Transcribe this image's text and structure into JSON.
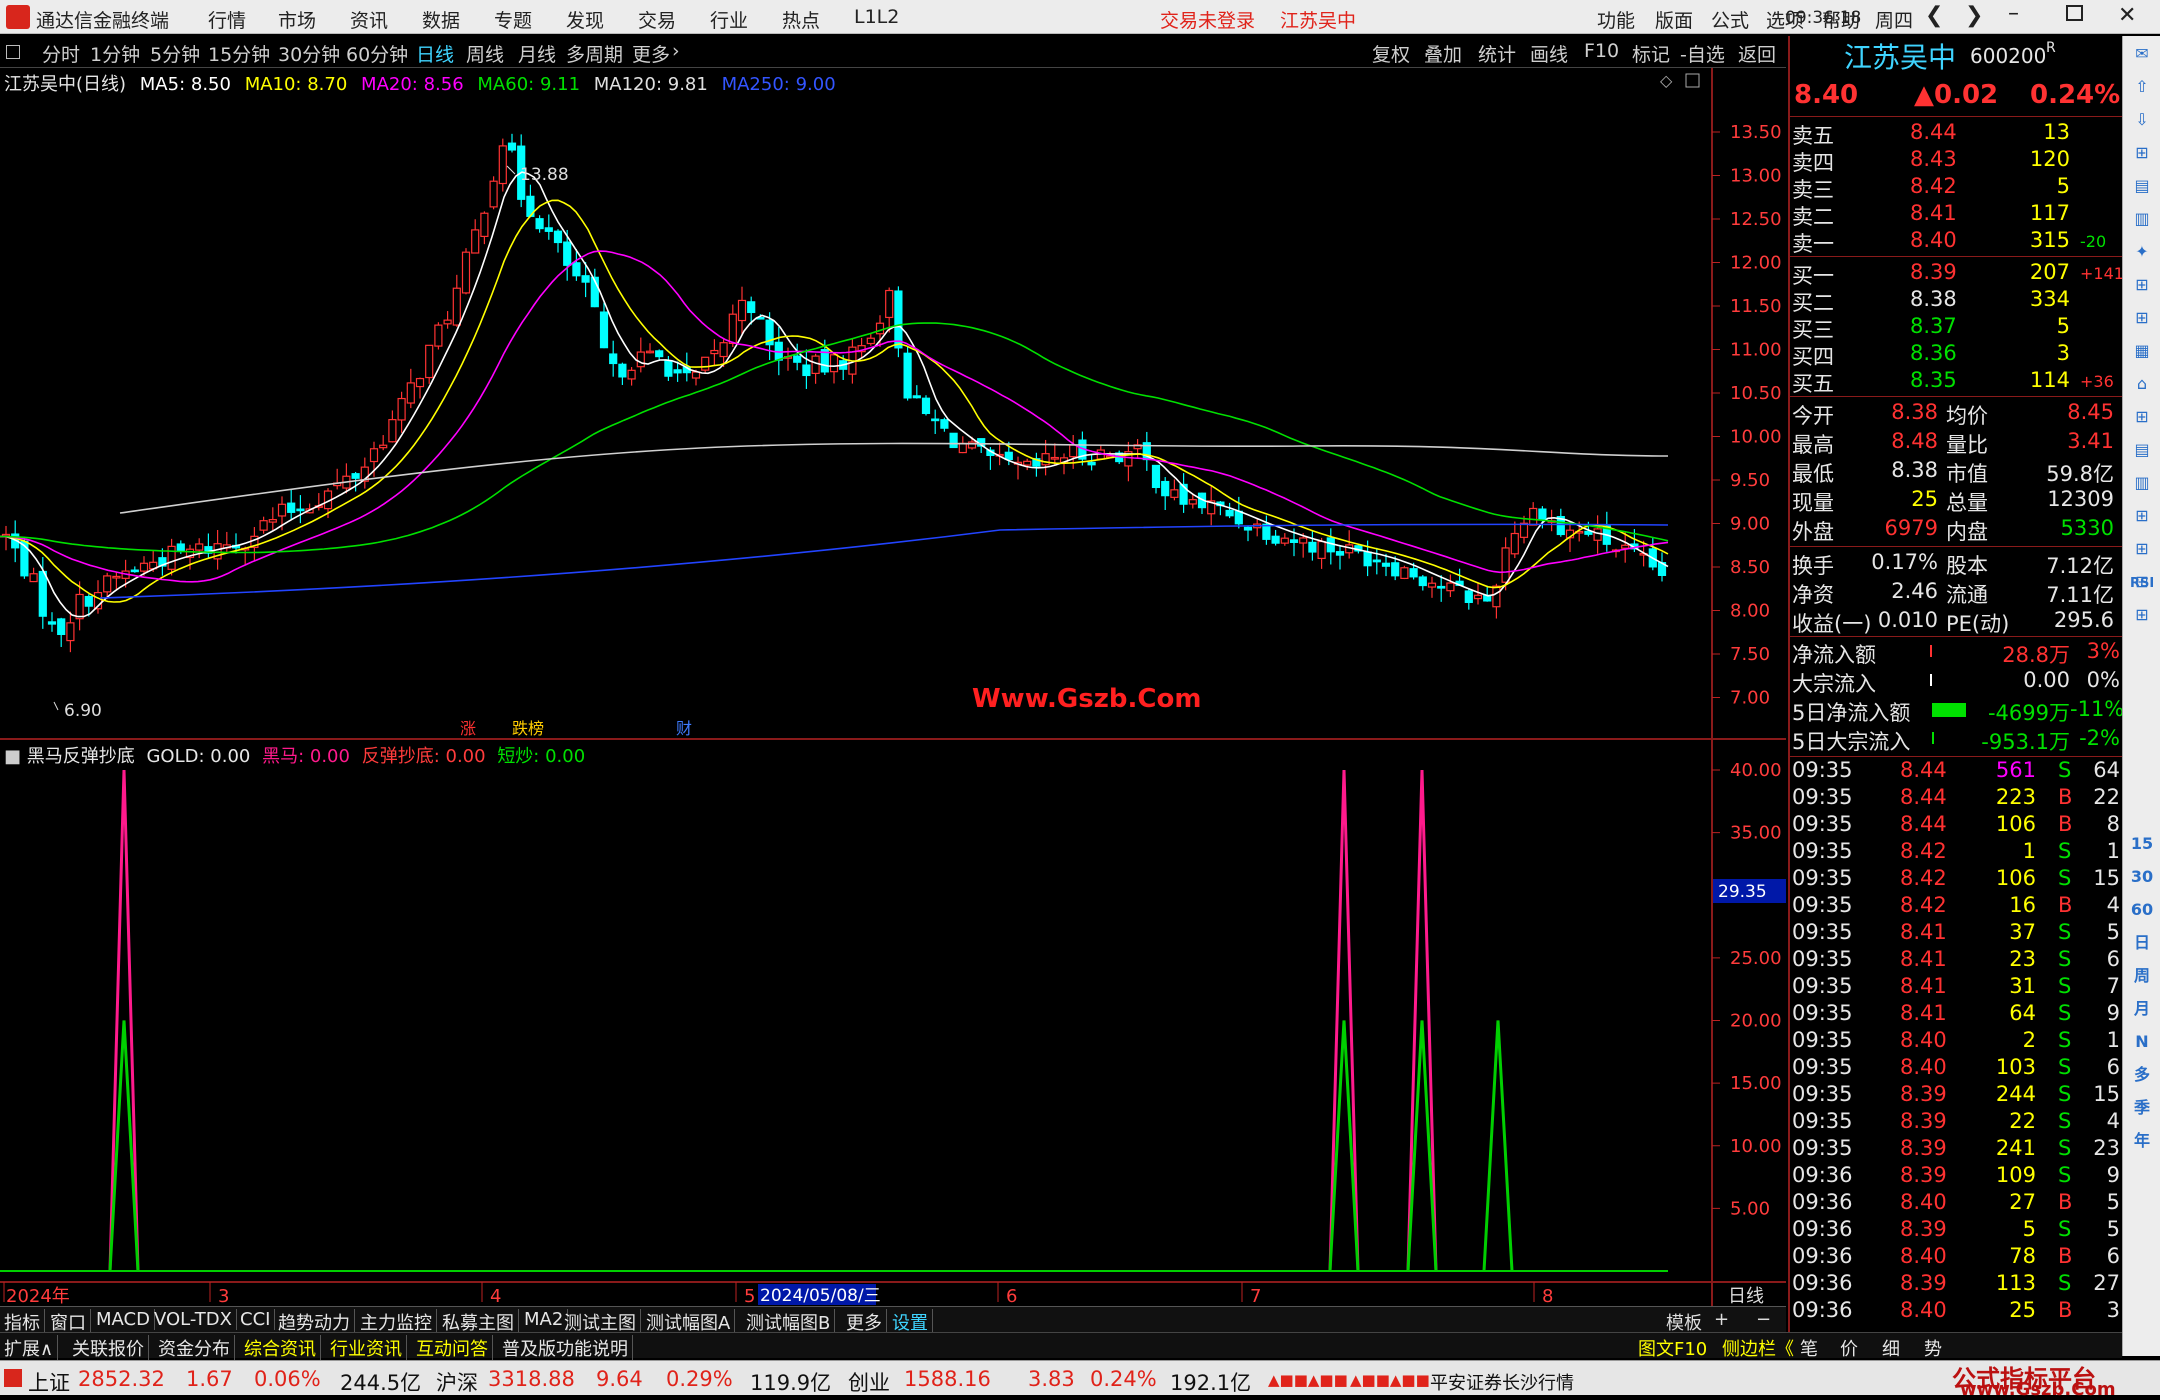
{
  "app": {
    "title": "通达信金融终端",
    "menu": [
      "行情",
      "市场",
      "资讯",
      "数据",
      "专题",
      "发现",
      "交易",
      "行业",
      "热点",
      "L1L2"
    ],
    "trade_status": "交易未登录",
    "stock_name_title": "江苏吴中",
    "menu_right": [
      "功能",
      "版面",
      "公式",
      "选项",
      "帮助"
    ],
    "time": "09:36:18",
    "weekday": "周四"
  },
  "periods": [
    "分时",
    "1分钟",
    "5分钟",
    "15分钟",
    "30分钟",
    "60分钟",
    "日线",
    "周线",
    "月线",
    "多周期",
    "更多"
  ],
  "toolbar_right": [
    "复权",
    "叠加",
    "统计",
    "画线",
    "F10",
    "标记",
    "-自选",
    "返回"
  ],
  "kline": {
    "header": {
      "stock": "江苏吴中(日线)",
      "ma5": "MA5: 8.50",
      "ma10": "MA10: 8.70",
      "ma20": "MA20: 8.56",
      "ma60": "MA60: 9.11",
      "ma120": "MA120: 9.81",
      "ma250": "MA250: 9.00"
    },
    "high_mark": "13.88",
    "low_mark": "6.90",
    "y_ticks": [
      "13.50",
      "13.00",
      "12.50",
      "12.00",
      "11.50",
      "11.00",
      "10.50",
      "10.00",
      "9.50",
      "9.00",
      "8.50",
      "8.00",
      "7.50",
      "7.00"
    ],
    "badges": [
      "涨",
      "跌榜",
      "财"
    ],
    "watermark": "Www.Gszb.Com",
    "colors": {
      "ma5": "#ffffff",
      "ma10": "#ffff00",
      "ma20": "#ff00ff",
      "ma60": "#00e000",
      "ma120": "#e0e0e0",
      "ma250": "#2244ff",
      "up": "#ff3232",
      "down": "#00ffff"
    }
  },
  "chart_data": [
    {
      "type": "candlestick",
      "title": "江苏吴中(日线)",
      "ylim": [
        6.8,
        14.0
      ],
      "y_high": 13.88,
      "y_low": 6.9,
      "series": [
        {
          "name": "MA5"
        },
        {
          "name": "MA10"
        },
        {
          "name": "MA20"
        },
        {
          "name": "MA60"
        },
        {
          "name": "MA120"
        },
        {
          "name": "MA250"
        }
      ]
    },
    {
      "type": "line",
      "title": "黑马反弹抄底",
      "ylim": [
        0,
        42
      ],
      "series": [
        {
          "name": "黑马",
          "color": "#ff1a8c",
          "peaks": [
            {
              "x": "2024-03-06",
              "y": 40
            },
            {
              "x": "2024-07-30",
              "y": 40
            },
            {
              "x": "2024-08-05",
              "y": 40
            }
          ]
        },
        {
          "name": "反弹抄底",
          "color": "#00d000",
          "peaks": [
            {
              "x": "2024-03-06",
              "y": 20
            },
            {
              "x": "2024-07-30",
              "y": 20
            },
            {
              "x": "2024-08-05",
              "y": 20
            },
            {
              "x": "2024-08-12",
              "y": 20
            }
          ]
        }
      ]
    }
  ],
  "indicator": {
    "header": {
      "name": "黑马反弹抄底",
      "gold": "GOLD: 0.00",
      "heima": "黑马: 0.00",
      "fantan": "反弹抄底: 0.00",
      "duanchao": "短炒: 0.00"
    },
    "y_ticks": [
      "40.00",
      "35.00",
      "25.00",
      "20.00",
      "15.00",
      "10.00",
      "5.00"
    ],
    "cursor_value": "29.35"
  },
  "x_axis": {
    "labels": [
      "2024年",
      "3",
      "4",
      "5",
      "6",
      "7",
      "8"
    ],
    "cursor_date": "2024/05/08/三",
    "period": "日线"
  },
  "tabs_indicator": [
    "指标",
    "窗口",
    "MACD",
    "VOL-TDX",
    "CCI",
    "趋势动力",
    "主力监控",
    "私募主图",
    "MA2",
    "测试主图",
    "测试幅图A",
    "测试幅图B",
    "更多",
    "设置"
  ],
  "tabs_right": [
    "模板",
    "+",
    "−"
  ],
  "tabs_info": [
    "扩展∧",
    "关联报价",
    "资金分布",
    "综合资讯",
    "行业资讯",
    "互动问答",
    "普及版功能说明"
  ],
  "tabs_info_right": [
    "图文F10",
    "侧边栏《",
    "笔",
    "价",
    "细",
    "势"
  ],
  "quote": {
    "name": "江苏吴中",
    "code": "600200",
    "flag": "R",
    "price": "8.40",
    "change": "▲0.02",
    "pct": "0.24%",
    "sell": [
      {
        "label": "卖五",
        "price": "8.44",
        "vol": "13",
        "chg": ""
      },
      {
        "label": "卖四",
        "price": "8.43",
        "vol": "120",
        "chg": ""
      },
      {
        "label": "卖三",
        "price": "8.42",
        "vol": "5",
        "chg": ""
      },
      {
        "label": "卖二",
        "price": "8.41",
        "vol": "117",
        "chg": ""
      },
      {
        "label": "卖一",
        "price": "8.40",
        "vol": "315",
        "chg": "-20"
      }
    ],
    "buy": [
      {
        "label": "买一",
        "price": "8.39",
        "vol": "207",
        "chg": "+141"
      },
      {
        "label": "买二",
        "price": "8.38",
        "vol": "334",
        "chg": ""
      },
      {
        "label": "买三",
        "price": "8.37",
        "vol": "5",
        "chg": ""
      },
      {
        "label": "买四",
        "price": "8.36",
        "vol": "3",
        "chg": ""
      },
      {
        "label": "买五",
        "price": "8.35",
        "vol": "114",
        "chg": "+36"
      }
    ],
    "stats": [
      {
        "l1": "今开",
        "v1": "8.38",
        "l2": "均价",
        "v2": "8.45"
      },
      {
        "l1": "最高",
        "v1": "8.48",
        "l2": "量比",
        "v2": "3.41"
      },
      {
        "l1": "最低",
        "v1": "8.38",
        "l2": "市值",
        "v2": "59.8亿"
      },
      {
        "l1": "现量",
        "v1": "25",
        "l2": "总量",
        "v2": "12309"
      },
      {
        "l1": "外盘",
        "v1": "6979",
        "l2": "内盘",
        "v2": "5330"
      }
    ],
    "stats2": [
      {
        "l1": "换手",
        "v1": "0.17%",
        "l2": "股本",
        "v2": "7.12亿"
      },
      {
        "l1": "净资",
        "v1": "2.46",
        "l2": "流通",
        "v2": "7.11亿"
      },
      {
        "l1": "收益(一)",
        "v1": "0.010",
        "l2": "PE(动)",
        "v2": "295.6"
      }
    ],
    "flows": [
      {
        "label": "净流入额",
        "value": "28.8万",
        "pct": "3%"
      },
      {
        "label": "大宗流入",
        "value": "0.00",
        "pct": "0%"
      },
      {
        "label": "5日净流入额",
        "value": "-4699万",
        "pct": "-11%"
      },
      {
        "label": "5日大宗流入",
        "value": "-953.1万",
        "pct": "-2%"
      }
    ],
    "ticks": [
      [
        "09:35",
        "8.44",
        "561",
        "S",
        "64"
      ],
      [
        "09:35",
        "8.44",
        "223",
        "B",
        "22"
      ],
      [
        "09:35",
        "8.44",
        "106",
        "B",
        "8"
      ],
      [
        "09:35",
        "8.42",
        "1",
        "S",
        "1"
      ],
      [
        "09:35",
        "8.42",
        "106",
        "S",
        "15"
      ],
      [
        "09:35",
        "8.42",
        "16",
        "B",
        "4"
      ],
      [
        "09:35",
        "8.41",
        "37",
        "S",
        "5"
      ],
      [
        "09:35",
        "8.41",
        "23",
        "S",
        "6"
      ],
      [
        "09:35",
        "8.41",
        "31",
        "S",
        "7"
      ],
      [
        "09:35",
        "8.41",
        "64",
        "S",
        "9"
      ],
      [
        "09:35",
        "8.40",
        "2",
        "S",
        "1"
      ],
      [
        "09:35",
        "8.40",
        "103",
        "S",
        "6"
      ],
      [
        "09:35",
        "8.39",
        "244",
        "S",
        "15"
      ],
      [
        "09:35",
        "8.39",
        "22",
        "S",
        "4"
      ],
      [
        "09:35",
        "8.39",
        "241",
        "S",
        "23"
      ],
      [
        "09:36",
        "8.39",
        "109",
        "S",
        "9"
      ],
      [
        "09:36",
        "8.40",
        "27",
        "B",
        "5"
      ],
      [
        "09:36",
        "8.39",
        "5",
        "S",
        "5"
      ],
      [
        "09:36",
        "8.40",
        "78",
        "B",
        "6"
      ],
      [
        "09:36",
        "8.39",
        "113",
        "S",
        "27"
      ],
      [
        "09:36",
        "8.40",
        "25",
        "B",
        "3"
      ]
    ]
  },
  "sidebar": {
    "labels": [
      "RSI",
      "15",
      "30",
      "60",
      "日",
      "周",
      "月",
      "N",
      "多",
      "季",
      "年"
    ]
  },
  "status": {
    "sh_label": "上证",
    "sh_val": "2852.32",
    "sh_chg": "1.67",
    "sh_pct": "0.06%",
    "sh_amt": "244.5亿",
    "sz_label": "沪深",
    "sz_val": "3318.88",
    "sz_chg": "9.64",
    "sz_pct": "0.29%",
    "sz_amt": "119.9亿",
    "cy_label": "创业",
    "cy_val": "1588.16",
    "cy_chg": "3.83",
    "cy_pct": "0.24%",
    "cy_amt": "192.1亿",
    "server": "平安证券长沙行情",
    "brand": "公式指标平台",
    "brand_url": "www.Gszb.Com"
  }
}
